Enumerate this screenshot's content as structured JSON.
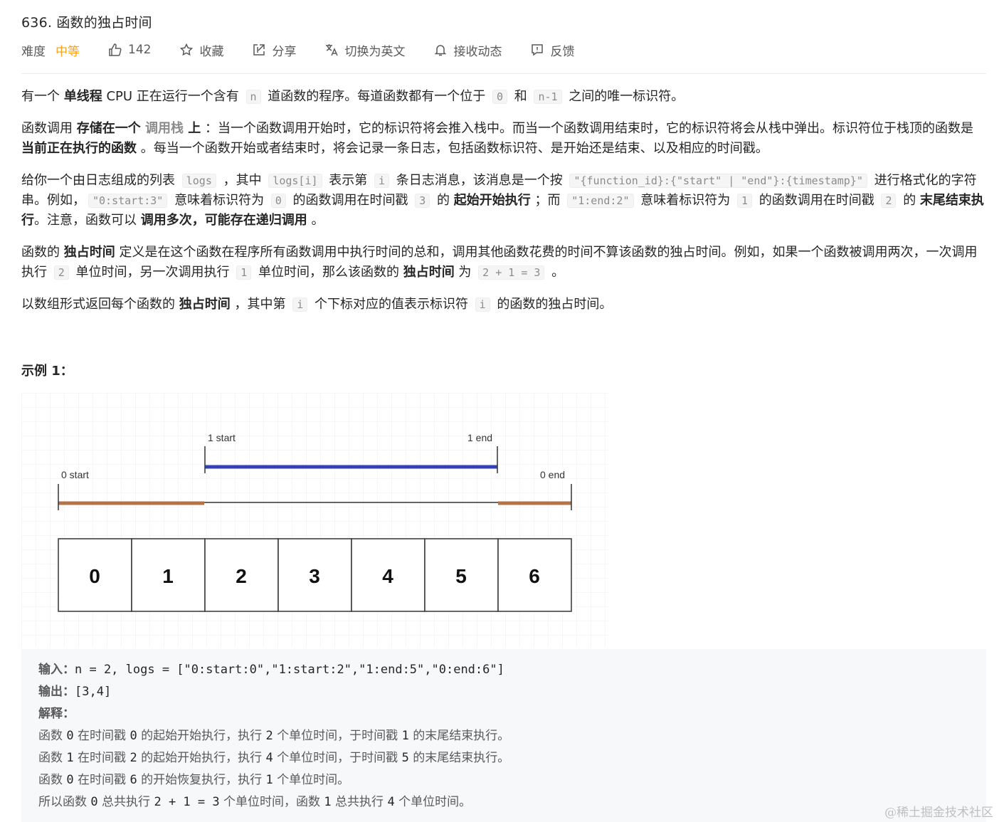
{
  "problem": {
    "title": "636. 函数的独占时间"
  },
  "toolbar": {
    "difficulty_label": "难度",
    "difficulty_value": "中等",
    "like_count": "142",
    "favorite": "收藏",
    "share": "分享",
    "switch_lang": "切换为英文",
    "subscribe": "接收动态",
    "feedback": "反馈",
    "colors": {
      "difficulty_medium": "#ffa116"
    }
  },
  "description": {
    "p1": [
      "有一个 ",
      "单线程",
      " CPU 正在运行一个含有 ",
      "n",
      " 道函数的程序。每道函数都有一个位于 ",
      "0",
      " 和 ",
      "n-1",
      " 之间的唯一标识符。"
    ],
    "p2": [
      "函数调用 ",
      "存储在一个 ",
      "调用栈",
      " 上",
      " ：当一个函数调用开始时，它的标识符将会推入栈中。而当一个函数调用结束时，它的标识符将会从栈中弹出。标识符位于栈顶的函数是 ",
      "当前正在执行的函数",
      " 。每当一个函数开始或者结束时，将会记录一条日志，包括函数标识符、是开始还是结束、以及相应的时间戳。"
    ],
    "p3": [
      "给你一个由日志组成的列表 ",
      "logs",
      " ，其中 ",
      "logs[i]",
      " 表示第 ",
      "i",
      " 条日志消息，该消息是一个按 ",
      "\"{function_id}:{\"start\" | \"end\"}:{timestamp}\"",
      " 进行格式化的字符串。例如，",
      "\"0:start:3\"",
      " 意味着标识符为 ",
      "0",
      " 的函数调用在时间戳 ",
      "3",
      " 的 ",
      "起始开始执行",
      " ；而 ",
      "\"1:end:2\"",
      " 意味着标识符为 ",
      "1",
      " 的函数调用在时间戳 ",
      "2",
      " 的 ",
      "末尾结束执行",
      "。注意，函数可以 ",
      "调用多次，可能存在递归调用",
      " 。"
    ],
    "p4": [
      "函数的 ",
      "独占时间",
      " 定义是在这个函数在程序所有函数调用中执行时间的总和，调用其他函数花费的时间不算该函数的独占时间。例如，如果一个函数被调用两次，一次调用执行 ",
      "2",
      " 单位时间，另一次调用执行 ",
      "1",
      " 单位时间，那么该函数的 ",
      "独占时间",
      " 为 ",
      "2 + 1 = 3",
      " 。"
    ],
    "p5": [
      "以数组形式返回每个函数的 ",
      "独占时间",
      " ，其中第 ",
      "i",
      " 个下标对应的值表示标识符 ",
      "i",
      " 的函数的独占时间。"
    ]
  },
  "example": {
    "title": "示例 1：",
    "figure": {
      "labels": {
        "start0": "0 start",
        "start1": "1 start",
        "end1": "1 end",
        "end0": "0 end"
      },
      "cells": [
        "0",
        "1",
        "2",
        "3",
        "4",
        "5",
        "6"
      ],
      "colors": {
        "func0": "#b5734a",
        "func1": "#3440b8"
      }
    },
    "input_label": "输入：",
    "input_value": "n = 2, logs = [\"0:start:0\",\"1:start:2\",\"1:end:5\",\"0:end:6\"]",
    "output_label": "输出：",
    "output_value": "[3,4]",
    "explain_label": "解释：",
    "explain_lines": [
      [
        "函数 ",
        "0",
        " 在时间戳 ",
        "0",
        " 的起始开始执行，执行 ",
        "2",
        " 个单位时间，于时间戳 ",
        "1",
        " 的末尾结束执行。"
      ],
      [
        "函数 ",
        "1",
        " 在时间戳 ",
        "2",
        " 的起始开始执行，执行 ",
        "4",
        " 个单位时间，于时间戳 ",
        "5",
        " 的末尾结束执行。"
      ],
      [
        "函数 ",
        "0",
        " 在时间戳 ",
        "6",
        " 的开始恢复执行，执行 ",
        "1",
        " 个单位时间。"
      ],
      [
        "所以函数 ",
        "0",
        " 总共执行 ",
        "2 + 1 = 3",
        " 个单位时间，函数 ",
        "1",
        " 总共执行 ",
        "4",
        " 个单位时间。"
      ]
    ]
  },
  "watermark": "@稀土掘金技术社区"
}
